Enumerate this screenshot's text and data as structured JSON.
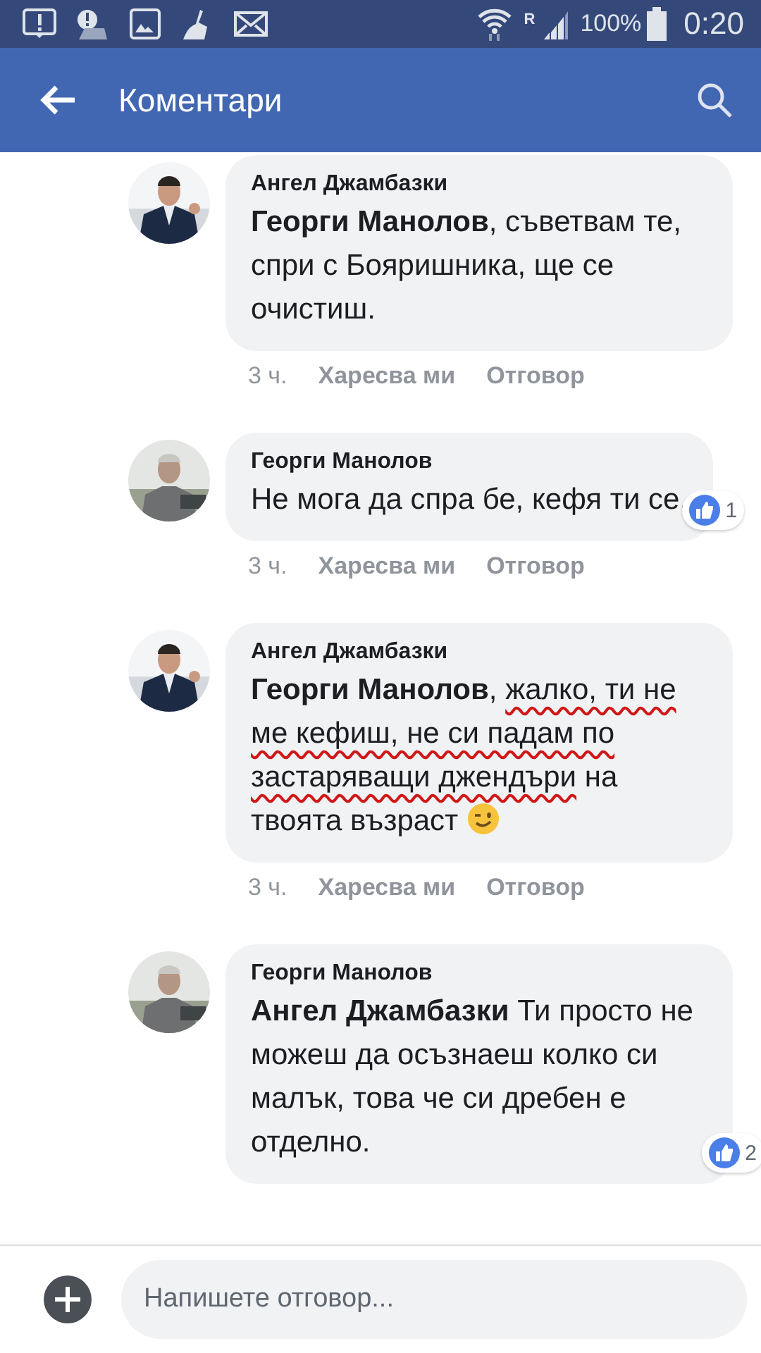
{
  "status_bar": {
    "roaming_label": "R",
    "battery": "100%",
    "time": "0:20"
  },
  "app_bar": {
    "title": "Коментари"
  },
  "comments": [
    {
      "author": "Ангел Джамбазки",
      "body": [
        {
          "kind": "mention",
          "text": "Георги Манолов"
        },
        {
          "kind": "plain",
          "text": ", съветвам те, спри с Бояришника, ще се очистиш."
        }
      ],
      "time": "3 ч.",
      "like_action": "Харесва ми",
      "reply_action": "Отговор"
    },
    {
      "author": "Георги Манолов",
      "body": [
        {
          "kind": "plain",
          "text": "Не мога да спра бе, кефя ти се."
        }
      ],
      "likes": "1",
      "time": "3 ч.",
      "like_action": "Харесва ми",
      "reply_action": "Отговор"
    },
    {
      "author": "Ангел Джамбазки",
      "body": [
        {
          "kind": "mention",
          "text": "Георги Манолов"
        },
        {
          "kind": "plain",
          "text": ", "
        },
        {
          "kind": "underlined",
          "text": "жалко, ти не ме кефиш, не си падам по застаряващи джендъри"
        },
        {
          "kind": "plain",
          "text": " на твоята възраст"
        },
        {
          "kind": "emoji"
        }
      ],
      "time": "3 ч.",
      "like_action": "Харесва ми",
      "reply_action": "Отговор"
    },
    {
      "author": "Георги Манолов",
      "body": [
        {
          "kind": "mention",
          "text": "Ангел Джамбазки"
        },
        {
          "kind": "plain",
          "text": "  Ти просто не можеш да осъзнаеш колко си малък, това че си дребен е отделно."
        }
      ],
      "likes": "2"
    }
  ],
  "reply_bar": {
    "placeholder": "Напишете отговор..."
  }
}
